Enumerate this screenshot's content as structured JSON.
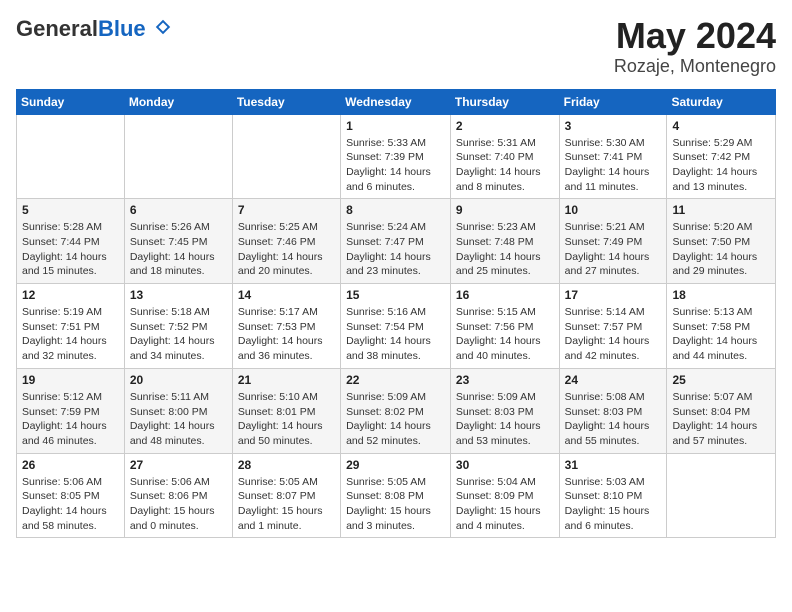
{
  "header": {
    "logo_general": "General",
    "logo_blue": "Blue",
    "month_year": "May 2024",
    "location": "Rozaje, Montenegro"
  },
  "weekdays": [
    "Sunday",
    "Monday",
    "Tuesday",
    "Wednesday",
    "Thursday",
    "Friday",
    "Saturday"
  ],
  "weeks": [
    [
      {
        "day": "",
        "info": ""
      },
      {
        "day": "",
        "info": ""
      },
      {
        "day": "",
        "info": ""
      },
      {
        "day": "1",
        "info": "Sunrise: 5:33 AM\nSunset: 7:39 PM\nDaylight: 14 hours\nand 6 minutes."
      },
      {
        "day": "2",
        "info": "Sunrise: 5:31 AM\nSunset: 7:40 PM\nDaylight: 14 hours\nand 8 minutes."
      },
      {
        "day": "3",
        "info": "Sunrise: 5:30 AM\nSunset: 7:41 PM\nDaylight: 14 hours\nand 11 minutes."
      },
      {
        "day": "4",
        "info": "Sunrise: 5:29 AM\nSunset: 7:42 PM\nDaylight: 14 hours\nand 13 minutes."
      }
    ],
    [
      {
        "day": "5",
        "info": "Sunrise: 5:28 AM\nSunset: 7:44 PM\nDaylight: 14 hours\nand 15 minutes."
      },
      {
        "day": "6",
        "info": "Sunrise: 5:26 AM\nSunset: 7:45 PM\nDaylight: 14 hours\nand 18 minutes."
      },
      {
        "day": "7",
        "info": "Sunrise: 5:25 AM\nSunset: 7:46 PM\nDaylight: 14 hours\nand 20 minutes."
      },
      {
        "day": "8",
        "info": "Sunrise: 5:24 AM\nSunset: 7:47 PM\nDaylight: 14 hours\nand 23 minutes."
      },
      {
        "day": "9",
        "info": "Sunrise: 5:23 AM\nSunset: 7:48 PM\nDaylight: 14 hours\nand 25 minutes."
      },
      {
        "day": "10",
        "info": "Sunrise: 5:21 AM\nSunset: 7:49 PM\nDaylight: 14 hours\nand 27 minutes."
      },
      {
        "day": "11",
        "info": "Sunrise: 5:20 AM\nSunset: 7:50 PM\nDaylight: 14 hours\nand 29 minutes."
      }
    ],
    [
      {
        "day": "12",
        "info": "Sunrise: 5:19 AM\nSunset: 7:51 PM\nDaylight: 14 hours\nand 32 minutes."
      },
      {
        "day": "13",
        "info": "Sunrise: 5:18 AM\nSunset: 7:52 PM\nDaylight: 14 hours\nand 34 minutes."
      },
      {
        "day": "14",
        "info": "Sunrise: 5:17 AM\nSunset: 7:53 PM\nDaylight: 14 hours\nand 36 minutes."
      },
      {
        "day": "15",
        "info": "Sunrise: 5:16 AM\nSunset: 7:54 PM\nDaylight: 14 hours\nand 38 minutes."
      },
      {
        "day": "16",
        "info": "Sunrise: 5:15 AM\nSunset: 7:56 PM\nDaylight: 14 hours\nand 40 minutes."
      },
      {
        "day": "17",
        "info": "Sunrise: 5:14 AM\nSunset: 7:57 PM\nDaylight: 14 hours\nand 42 minutes."
      },
      {
        "day": "18",
        "info": "Sunrise: 5:13 AM\nSunset: 7:58 PM\nDaylight: 14 hours\nand 44 minutes."
      }
    ],
    [
      {
        "day": "19",
        "info": "Sunrise: 5:12 AM\nSunset: 7:59 PM\nDaylight: 14 hours\nand 46 minutes."
      },
      {
        "day": "20",
        "info": "Sunrise: 5:11 AM\nSunset: 8:00 PM\nDaylight: 14 hours\nand 48 minutes."
      },
      {
        "day": "21",
        "info": "Sunrise: 5:10 AM\nSunset: 8:01 PM\nDaylight: 14 hours\nand 50 minutes."
      },
      {
        "day": "22",
        "info": "Sunrise: 5:09 AM\nSunset: 8:02 PM\nDaylight: 14 hours\nand 52 minutes."
      },
      {
        "day": "23",
        "info": "Sunrise: 5:09 AM\nSunset: 8:03 PM\nDaylight: 14 hours\nand 53 minutes."
      },
      {
        "day": "24",
        "info": "Sunrise: 5:08 AM\nSunset: 8:03 PM\nDaylight: 14 hours\nand 55 minutes."
      },
      {
        "day": "25",
        "info": "Sunrise: 5:07 AM\nSunset: 8:04 PM\nDaylight: 14 hours\nand 57 minutes."
      }
    ],
    [
      {
        "day": "26",
        "info": "Sunrise: 5:06 AM\nSunset: 8:05 PM\nDaylight: 14 hours\nand 58 minutes."
      },
      {
        "day": "27",
        "info": "Sunrise: 5:06 AM\nSunset: 8:06 PM\nDaylight: 15 hours\nand 0 minutes."
      },
      {
        "day": "28",
        "info": "Sunrise: 5:05 AM\nSunset: 8:07 PM\nDaylight: 15 hours\nand 1 minute."
      },
      {
        "day": "29",
        "info": "Sunrise: 5:05 AM\nSunset: 8:08 PM\nDaylight: 15 hours\nand 3 minutes."
      },
      {
        "day": "30",
        "info": "Sunrise: 5:04 AM\nSunset: 8:09 PM\nDaylight: 15 hours\nand 4 minutes."
      },
      {
        "day": "31",
        "info": "Sunrise: 5:03 AM\nSunset: 8:10 PM\nDaylight: 15 hours\nand 6 minutes."
      },
      {
        "day": "",
        "info": ""
      }
    ]
  ]
}
